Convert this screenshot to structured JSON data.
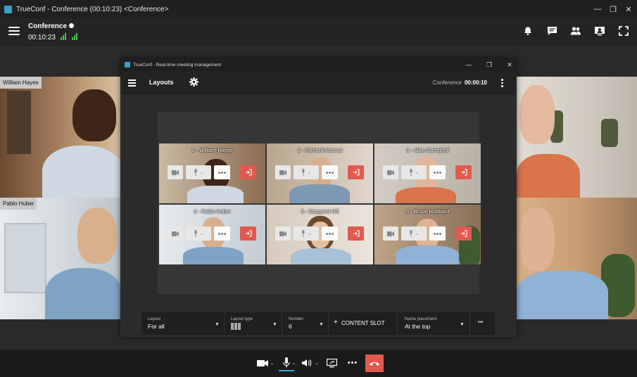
{
  "window": {
    "title": "TrueConf - Conference (00:10:23) <Conference>",
    "controls": [
      "—",
      "❐",
      "✕"
    ]
  },
  "header": {
    "conference_name": "Conference",
    "elapsed": "00:10:23",
    "icons": [
      "bell-icon",
      "chat-icon",
      "participants-icon",
      "content-sharing-icon",
      "fullscreen-icon"
    ]
  },
  "participants": [
    {
      "name": "William Hayes"
    },
    {
      "name": "Pablo Huber"
    }
  ],
  "dialog": {
    "title": "TrueConf - Real-time meeting management",
    "controls": [
      "—",
      "❐",
      "✕"
    ],
    "heading": "Layouts",
    "conference_label": "Conference",
    "elapsed": "00:00:10",
    "slots": [
      {
        "label": "1 - William Hayes"
      },
      {
        "label": "2 - Richard Atwood"
      },
      {
        "label": "3 - Alice Campbell"
      },
      {
        "label": "4 - Pablo Huber"
      },
      {
        "label": "5 - Margaret Hill"
      },
      {
        "label": "6 - Bruce Hubbard"
      }
    ],
    "bar": {
      "layout_label": "Layout",
      "layout_value": "For all",
      "layout_type_label": "Layout type",
      "number_label": "Number",
      "number_value": "6",
      "content_slot_label": "CONTENT SLOT",
      "name_placement_label": "Name placement",
      "name_placement_value": "At the top",
      "more_label": "•••"
    }
  },
  "toolbar": {
    "more_label": "•••",
    "icons": [
      "camera-icon",
      "microphone-icon",
      "speaker-icon",
      "screen-share-icon",
      "more-icon",
      "hangup-icon"
    ]
  },
  "colors": {
    "accent_red": "#e15a4f",
    "signal_green": "#47c24a",
    "app_dark": "#1e1e1e"
  }
}
